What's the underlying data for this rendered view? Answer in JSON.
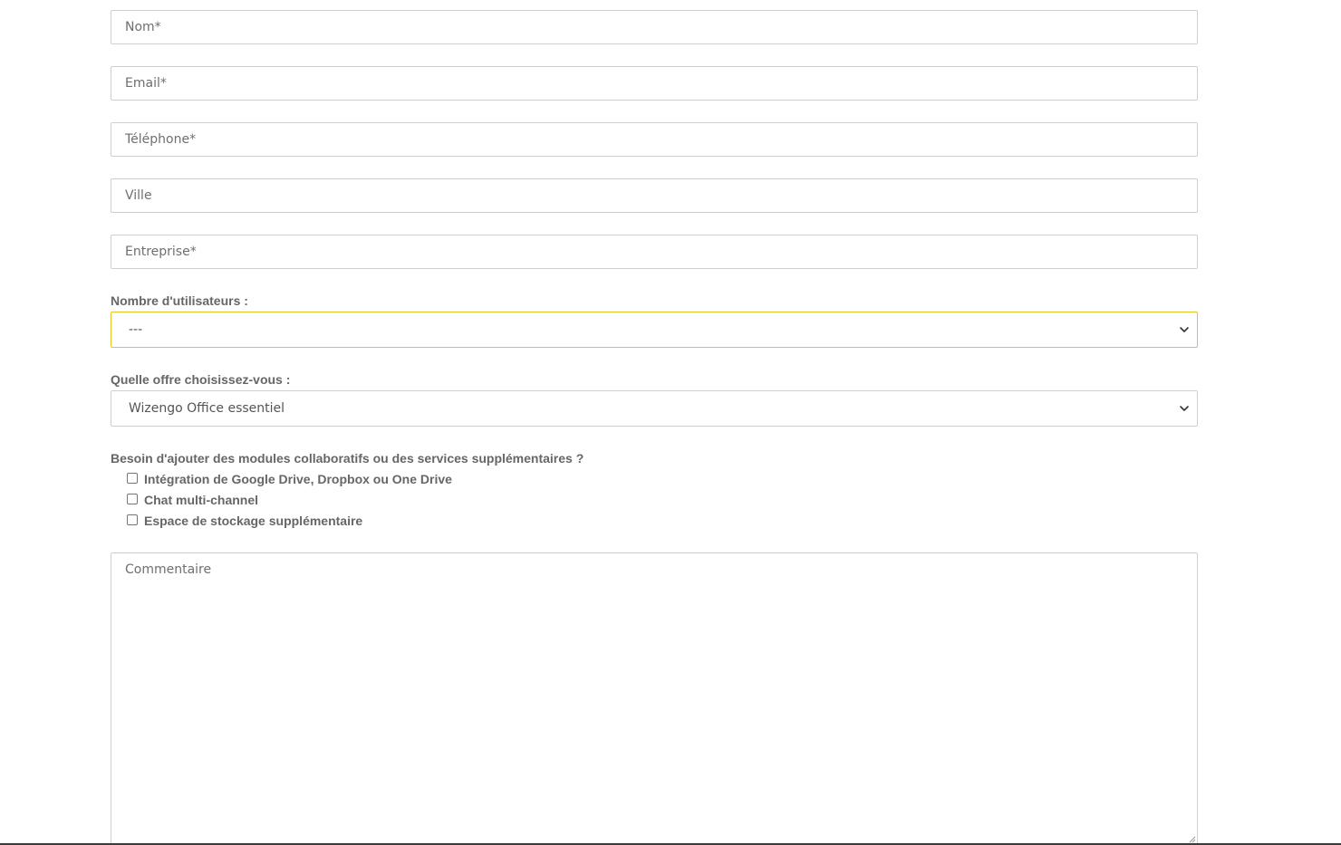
{
  "fields": {
    "nom": {
      "placeholder": "Nom*",
      "value": ""
    },
    "email": {
      "placeholder": "Email*",
      "value": ""
    },
    "telephone": {
      "placeholder": "Téléphone*",
      "value": ""
    },
    "ville": {
      "placeholder": "Ville",
      "value": ""
    },
    "entreprise": {
      "placeholder": "Entreprise*",
      "value": ""
    }
  },
  "users": {
    "label": "Nombre d'utilisateurs :",
    "selected": "---"
  },
  "offer": {
    "label": "Quelle offre choisissez-vous :",
    "selected": "Wizengo Office essentiel"
  },
  "modules": {
    "question": "Besoin d'ajouter des modules collaboratifs ou des services supplémentaires ?",
    "options": [
      {
        "label": "Intégration de Google Drive, Dropbox ou One Drive",
        "checked": false
      },
      {
        "label": "Chat multi-channel",
        "checked": false
      },
      {
        "label": "Espace de stockage supplémentaire",
        "checked": false
      }
    ]
  },
  "comment": {
    "placeholder": "Commentaire",
    "value": ""
  },
  "colors": {
    "focus_border": "#e3c22a",
    "input_border": "#cfcfcf",
    "label_text": "#666666"
  },
  "icons": {
    "select_arrow": "chevron-down-icon",
    "textarea_resize": "resize-grip-icon"
  }
}
